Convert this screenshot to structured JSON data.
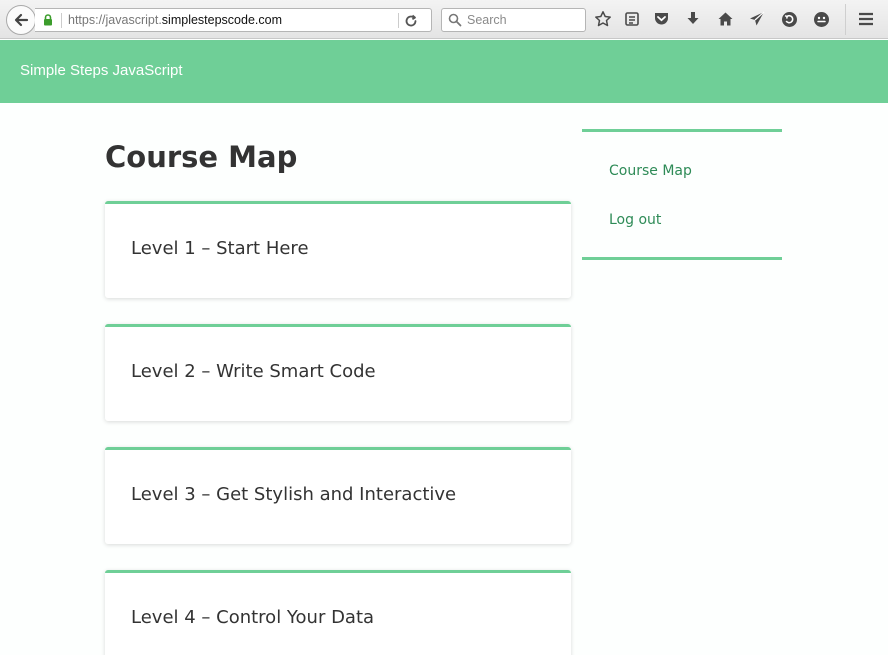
{
  "browser": {
    "url_prefix": "https://javascript.",
    "url_host": "simplestepscode.com",
    "search_placeholder": "Search",
    "icons": [
      "star-icon",
      "reading-list-icon",
      "pocket-icon",
      "download-icon",
      "home-icon",
      "send-icon",
      "sync-icon",
      "smiley-icon",
      "menu-icon"
    ]
  },
  "header": {
    "site_title": "Simple Steps JavaScript"
  },
  "main": {
    "title": "Course Map",
    "levels": [
      {
        "label": "Level 1 – Start Here"
      },
      {
        "label": "Level 2 – Write Smart Code"
      },
      {
        "label": "Level 3 – Get Stylish and Interactive"
      },
      {
        "label": "Level 4 – Control Your Data"
      }
    ]
  },
  "sidebar": {
    "links": [
      {
        "label": "Course Map"
      },
      {
        "label": "Log out"
      }
    ]
  },
  "colors": {
    "accent": "#6fcf97",
    "link": "#2e8b57"
  }
}
